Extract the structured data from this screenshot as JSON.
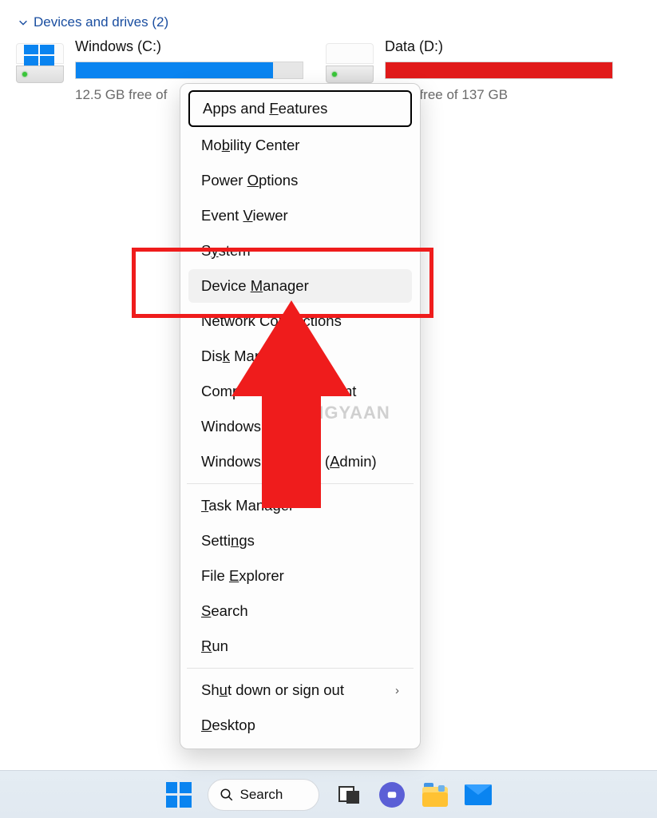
{
  "explorer": {
    "section_title": "Devices and drives (2)",
    "drives": [
      {
        "name": "Windows (C:)",
        "free_text": "12.5 GB free of",
        "fill_pct": 87,
        "fill_color": "bar-blue",
        "os_logo": true
      },
      {
        "name": "Data (D:)",
        "free_text": "0 GB free of 137 GB",
        "fill_pct": 100,
        "fill_color": "bar-red",
        "os_logo": false
      }
    ]
  },
  "winx_menu": {
    "items": [
      {
        "pre": "Apps and ",
        "accel": "F",
        "post": "eatures",
        "boxed": true,
        "hover": false
      },
      {
        "pre": "Mo",
        "accel": "b",
        "post": "ility Center"
      },
      {
        "pre": "Power ",
        "accel": "O",
        "post": "ptions"
      },
      {
        "pre": "Event ",
        "accel": "V",
        "post": "iewer"
      },
      {
        "pre": "S",
        "accel": "y",
        "post": "stem"
      },
      {
        "pre": "Device ",
        "accel": "M",
        "post": "anager",
        "hover": true
      },
      {
        "pre": "Network Co",
        "accel": "n",
        "post": "nections"
      },
      {
        "pre": "Dis",
        "accel": "k",
        "post": " Management"
      },
      {
        "pre": "Computer Mana",
        "accel": "g",
        "post": "ement"
      },
      {
        "pre": "Windows Term",
        "accel": "i",
        "post": "nal"
      },
      {
        "pre": "Windows Terminal (",
        "accel": "A",
        "post": "dmin)"
      }
    ],
    "items2": [
      {
        "pre": "",
        "accel": "T",
        "post": "ask Manager"
      },
      {
        "pre": "Setti",
        "accel": "n",
        "post": "gs"
      },
      {
        "pre": "File ",
        "accel": "E",
        "post": "xplorer"
      },
      {
        "pre": "",
        "accel": "S",
        "post": "earch"
      },
      {
        "pre": "",
        "accel": "R",
        "post": "un"
      }
    ],
    "items3": [
      {
        "pre": "Sh",
        "accel": "u",
        "post": "t down or sign out",
        "submenu": true
      },
      {
        "pre": "",
        "accel": "D",
        "post": "esktop"
      }
    ]
  },
  "watermark": {
    "pre": "M",
    "post": "BIGYAAN"
  },
  "taskbar": {
    "search_placeholder": "Search"
  }
}
